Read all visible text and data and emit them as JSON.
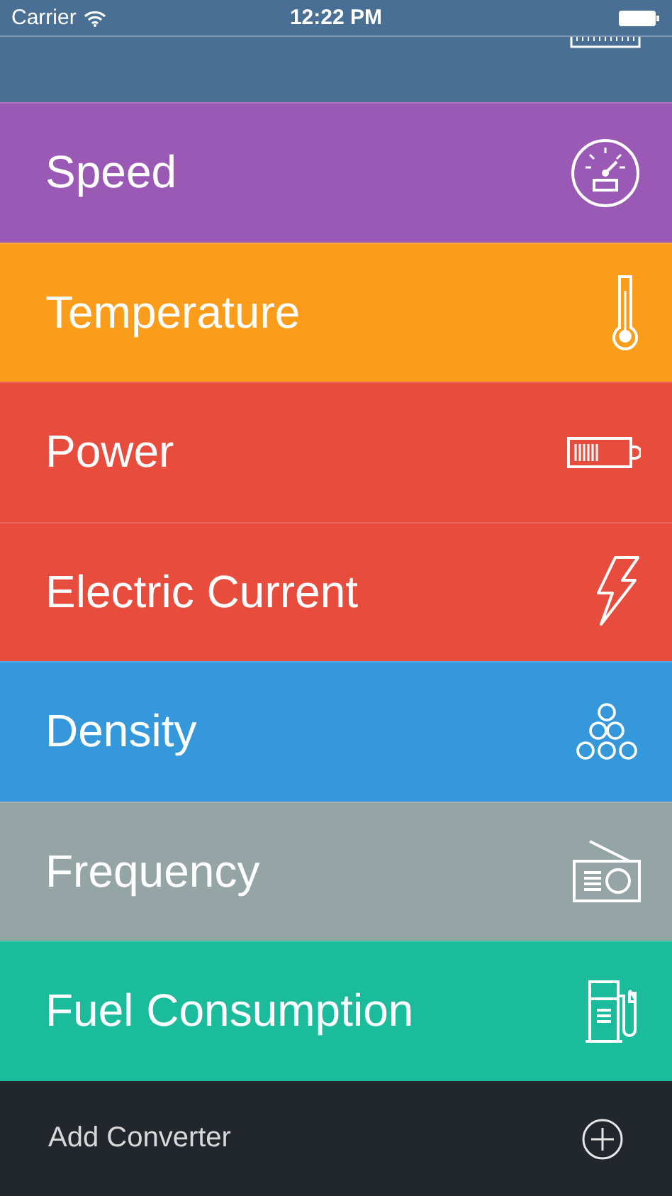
{
  "status_bar": {
    "carrier": "Carrier",
    "time": "12:22 PM"
  },
  "converters": [
    {
      "color": "#4a6f95",
      "kind": "ruler"
    },
    {
      "name": "Speed",
      "color": "#9b59b6",
      "kind": "gauge"
    },
    {
      "name": "Temperature",
      "color": "#fb9d1b",
      "kind": "thermometer"
    },
    {
      "name": "Power",
      "color": "#e84c3d",
      "kind": "battery"
    },
    {
      "name": "Electric Current",
      "color": "#e84c3d",
      "kind": "bolt"
    },
    {
      "name": "Density",
      "color": "#3498db",
      "kind": "spheres"
    },
    {
      "name": "Frequency",
      "color": "#95a5a6",
      "kind": "radio"
    },
    {
      "name": "Fuel Consumption",
      "color": "#1abc9c",
      "kind": "fuel"
    }
  ],
  "footer": {
    "label": "Add Converter"
  }
}
